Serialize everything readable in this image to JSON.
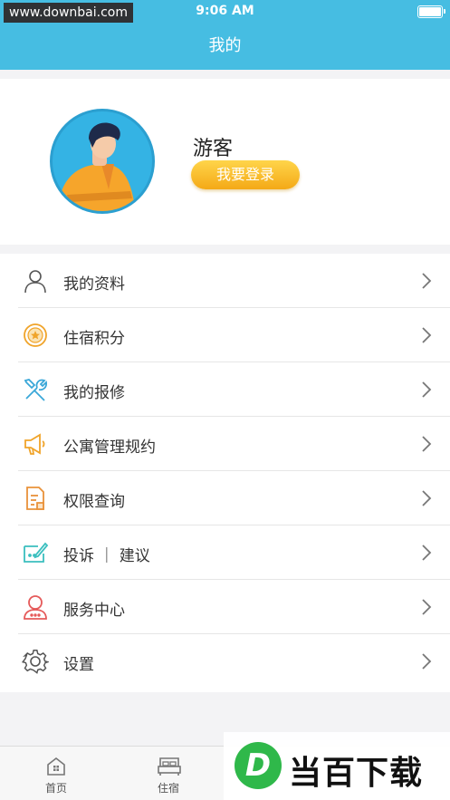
{
  "status_bar": {
    "watermark": "www.downbai.com",
    "time": "9:06 AM"
  },
  "header": {
    "title": "我的"
  },
  "profile": {
    "username": "游客",
    "login_label": "我要登录"
  },
  "menu": {
    "items": [
      {
        "label": "我的资料",
        "icon": "user-icon"
      },
      {
        "label": "住宿积分",
        "icon": "points-medal-icon"
      },
      {
        "label": "我的报修",
        "icon": "repair-tools-icon"
      },
      {
        "label": "公寓管理规约",
        "icon": "megaphone-icon"
      },
      {
        "label": "权限查询",
        "icon": "document-icon"
      },
      {
        "label": "投诉 ｜ 建议",
        "icon": "feedback-icon"
      },
      {
        "label": "服务中心",
        "icon": "service-agent-icon"
      },
      {
        "label": "设置",
        "icon": "gear-icon"
      }
    ]
  },
  "tabbar": {
    "tabs": [
      {
        "label": "首页",
        "icon": "home-icon"
      },
      {
        "label": "住宿",
        "icon": "bed-icon"
      }
    ]
  },
  "watermark_bottom": {
    "logo_letter": "D",
    "text": "当百下载"
  },
  "colors": {
    "header": "#46bde2",
    "login_button": "#f4a917",
    "watermark_logo": "#2fb84a"
  }
}
